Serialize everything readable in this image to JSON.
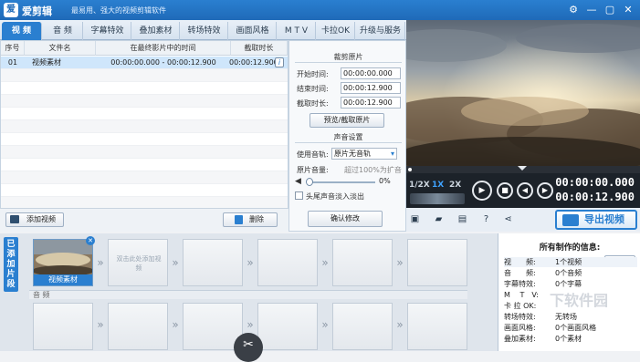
{
  "app": {
    "name": "爱剪辑",
    "slogan": "最易用、强大的视频剪辑软件",
    "logo_text": "爱"
  },
  "window": {
    "settings_glyph": "⚙",
    "minimize_glyph": "—",
    "maximize_glyph": "▢",
    "close_glyph": "✕"
  },
  "tabs": [
    {
      "label": "视 频",
      "active": true
    },
    {
      "label": "音 频",
      "active": false
    },
    {
      "label": "字幕特效",
      "active": false
    },
    {
      "label": "叠加素材",
      "active": false
    },
    {
      "label": "转场特效",
      "active": false
    },
    {
      "label": "画面风格",
      "active": false
    },
    {
      "label": "M T V",
      "active": false
    },
    {
      "label": "卡拉OK",
      "active": false
    },
    {
      "label": "升级与服务",
      "active": false
    }
  ],
  "clip_table": {
    "headers": [
      "序号",
      "文件名",
      "在最终影片中的时间",
      "截取时长"
    ],
    "rows": [
      {
        "index": "01",
        "filename": "视频素材",
        "time_range": "00:00:00.000 - 00:00:12.900",
        "duration": "00:00:12.900",
        "info_glyph": "i"
      }
    ]
  },
  "crop_panel": {
    "section_title": "裁剪原片",
    "start_label": "开始时间:",
    "start_value": "00:00:00.000",
    "end_label": "结束时间:",
    "end_value": "00:00:12.900",
    "dur_label": "截取时长:",
    "dur_value": "00:00:12.900",
    "preview_button": "预览/截取原片",
    "sound_title": "声音设置",
    "track_label": "使用音轨:",
    "track_value": "原片无音轨",
    "volume_label": "原片音量:",
    "volume_hint": "超过100%为扩音",
    "volume_value": "0%",
    "fade_label": "头尾声音淡入淡出",
    "confirm_button": "确认修改"
  },
  "left_buttons": {
    "add_video": "添加视频",
    "delete": "删除"
  },
  "player": {
    "speeds": [
      "1/2X",
      "1X",
      "2X"
    ],
    "active_speed": "1X",
    "current_time": "00:00:00.000",
    "total_time": "00:00:12.900",
    "progress": 0
  },
  "export_button": "导出视频",
  "storyboard": {
    "side_label": "已添加片段",
    "first_clip_label": "视频素材",
    "placeholder_text": "双击此处添加视频",
    "audio_label": "音 频"
  },
  "info_panel": {
    "title": "所有制作的信息:",
    "detail_button": "详细",
    "rows": [
      {
        "key": "视　　频:",
        "value": "1个视频"
      },
      {
        "key": "音　　频:",
        "value": "0个音频"
      },
      {
        "key": "字幕特效:",
        "value": "0个字幕"
      },
      {
        "key": "M　 T　V:",
        "value": ""
      },
      {
        "key": "卡 拉 OK:",
        "value": ""
      },
      {
        "key": "转场特效:",
        "value": "无转场"
      },
      {
        "key": "画面风格:",
        "value": "0个画面风格"
      },
      {
        "key": "叠加素材:",
        "value": "0个素材"
      }
    ]
  },
  "watermark": {
    "text": "下软件园"
  }
}
